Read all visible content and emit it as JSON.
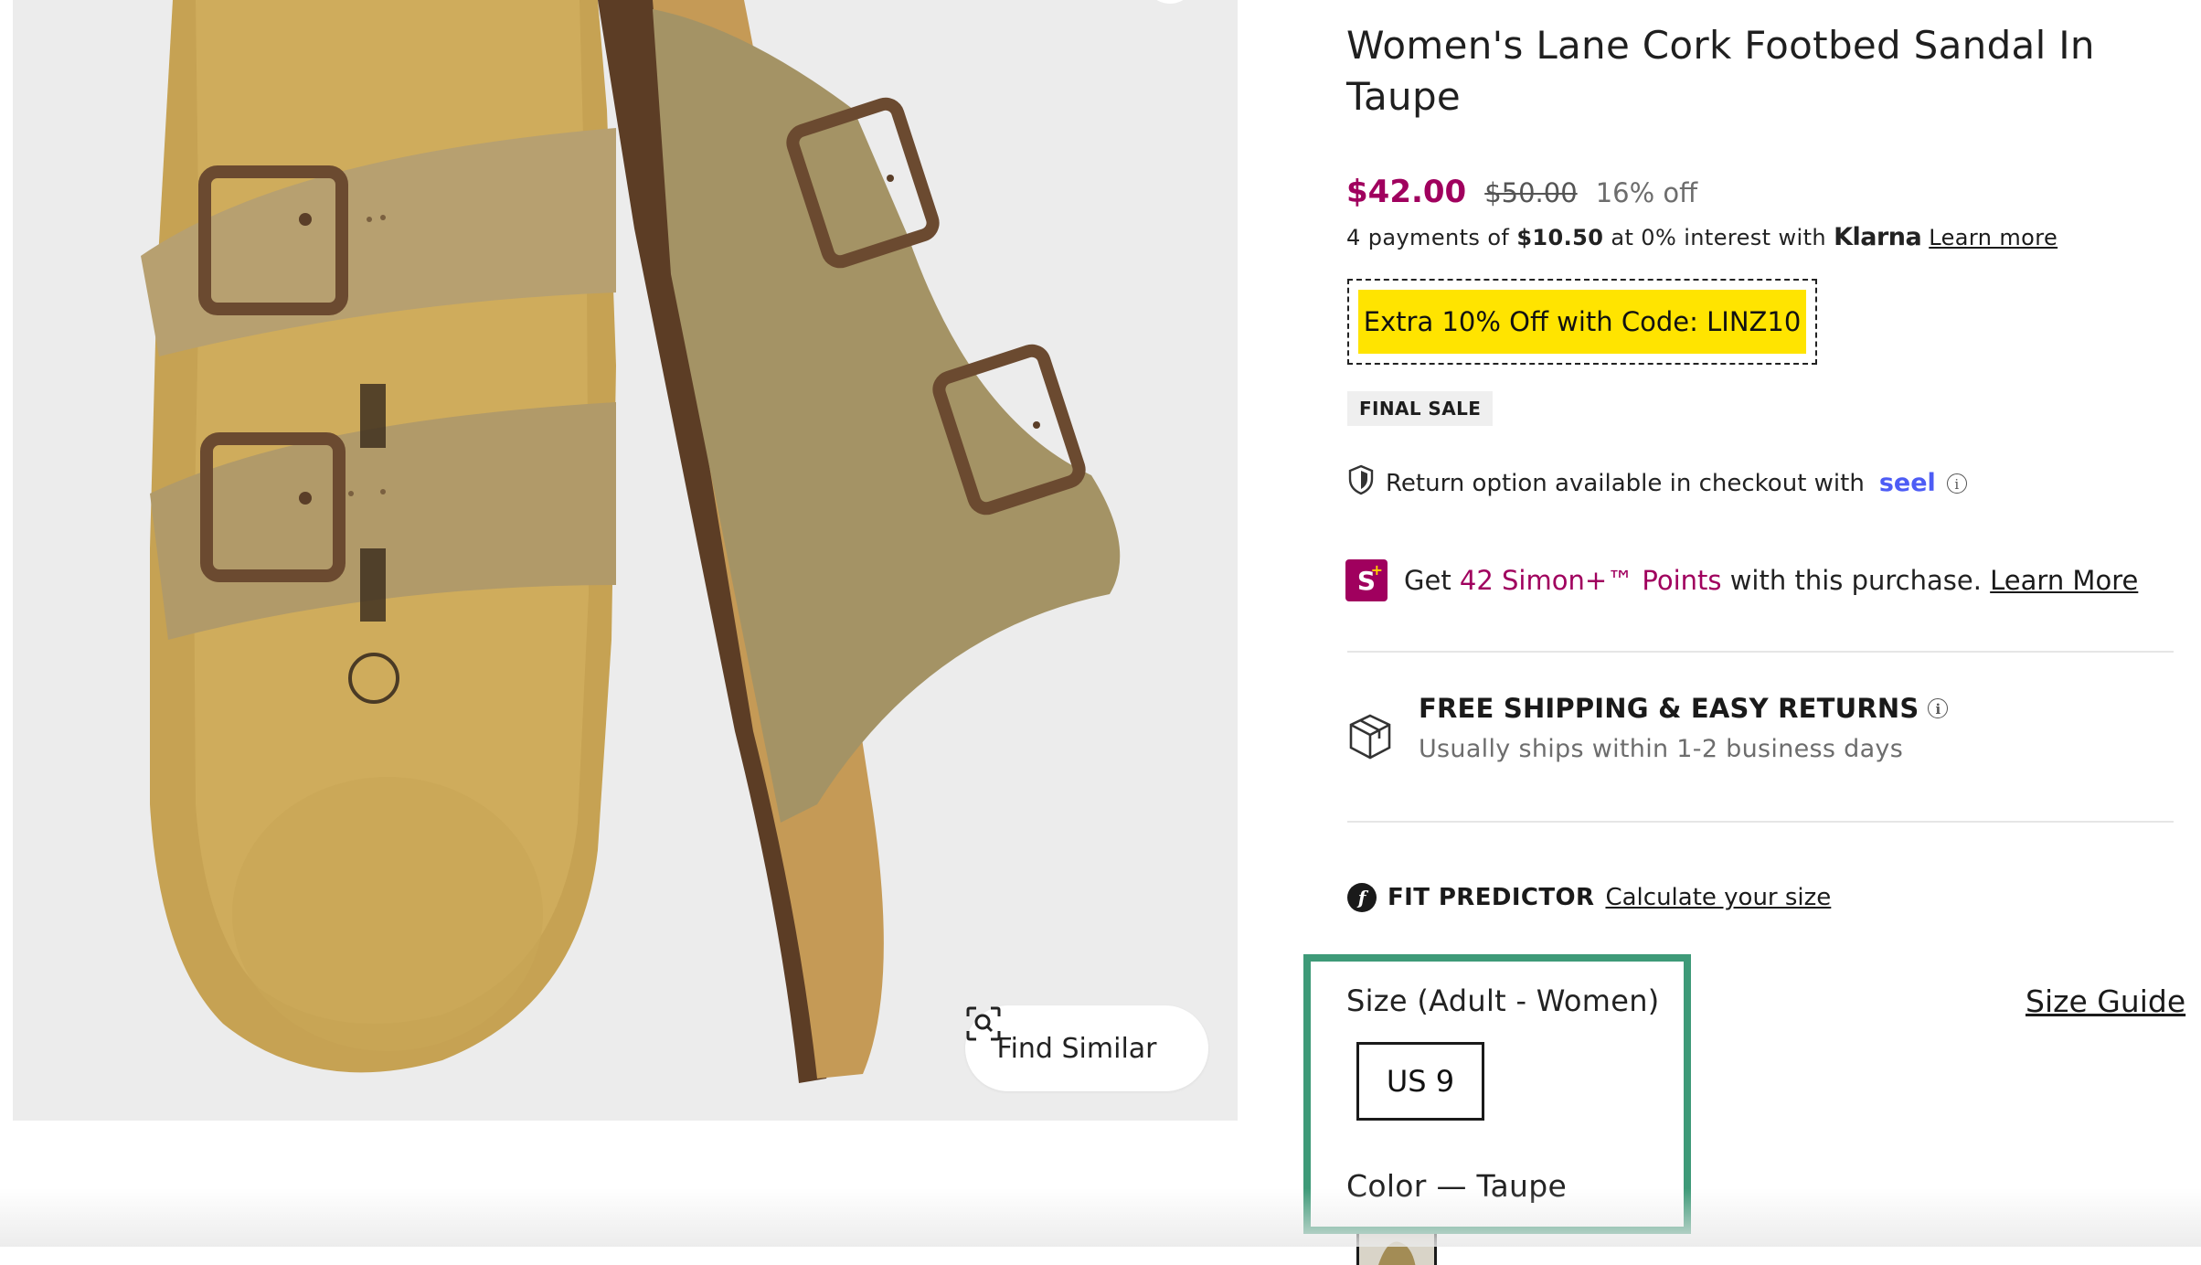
{
  "gallery": {
    "find_similar_label": "Find Similar",
    "icon": "visual-search-icon"
  },
  "product": {
    "title": "Women's Lane Cork Footbed Sandal In Taupe",
    "price_sale": "$42.00",
    "price_original": "$50.00",
    "discount": "16% off",
    "klarna": {
      "prefix": "4 payments of",
      "amount": "$10.50",
      "middle": "at 0% interest with",
      "brand": "Klarna",
      "link": "Learn more"
    },
    "promo_label": "Extra 10% Off with Code: LINZ10",
    "badge": "FINAL SALE",
    "return": {
      "text": "Return option available in checkout with",
      "brand": "seel",
      "icon": "shield-icon"
    },
    "simon": {
      "badge": "S",
      "prefix": "Get",
      "points": "42 Simon+™ Points",
      "suffix": "with this purchase.",
      "link": "Learn More"
    },
    "shipping": {
      "title": "FREE SHIPPING & EASY RETURNS",
      "subtitle": "Usually ships within 1-2 business days",
      "icon": "package-icon"
    },
    "fit": {
      "logo": "f",
      "label": "FIT PREDICTOR",
      "link": "Calculate your size"
    },
    "size": {
      "label": "Size (Adult - Women)",
      "guide_link": "Size Guide",
      "selected": "US 9"
    },
    "color": {
      "label": "Color — Taupe"
    }
  },
  "colors": {
    "brand": "#a0005e",
    "promo": "#ffe400",
    "seel": "#4d5cf5",
    "highlight": "#3e9a78"
  }
}
